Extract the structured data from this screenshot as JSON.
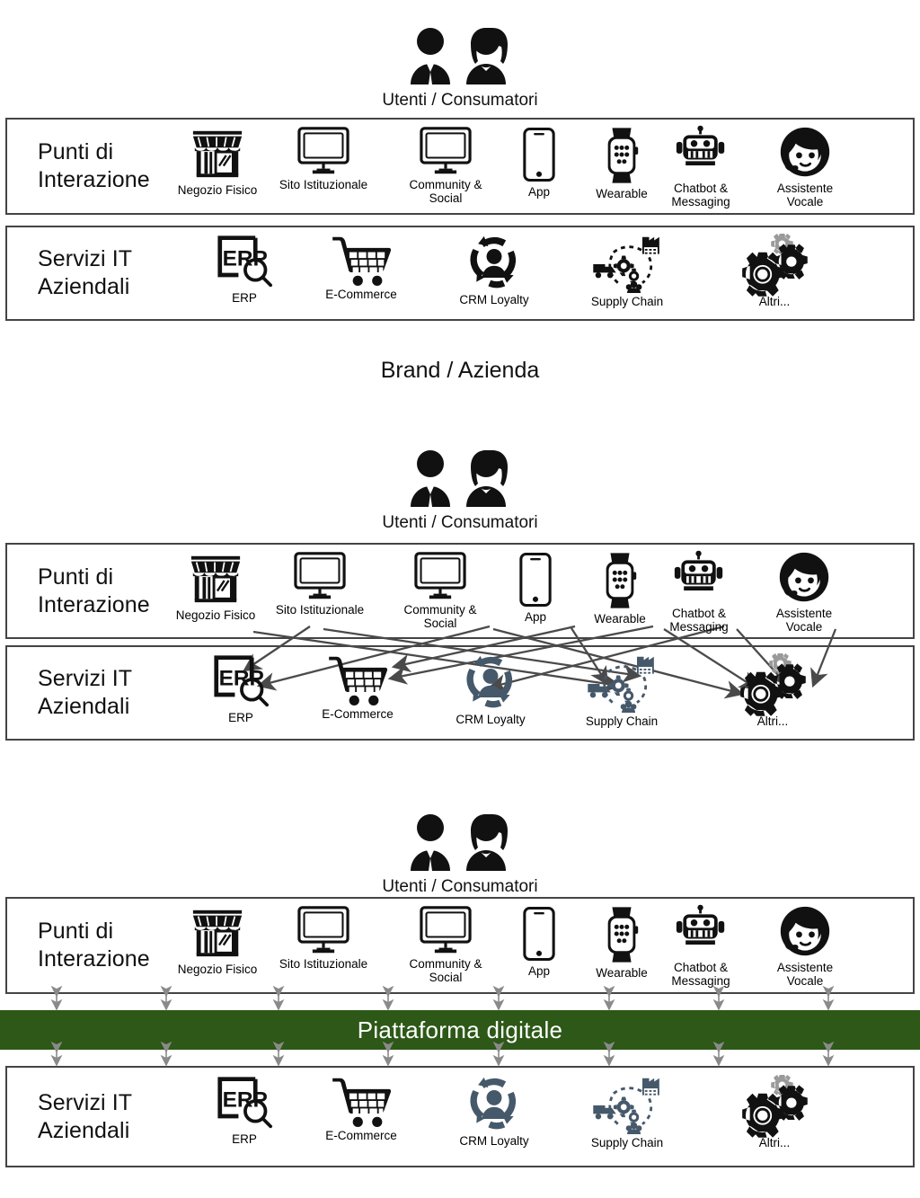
{
  "diagram": {
    "title_text": "Brand / Azienda",
    "users_label": "Utenti / Consumatori",
    "platform_label": "Piattaforma digitale",
    "row_labels": {
      "touchpoints": "Punti di\nInterazione",
      "it_services": "Servizi IT\nAziendali"
    },
    "colors": {
      "platform_green": "#2d5817",
      "panel_border": "#444444",
      "icon_black": "#111111",
      "icon_slate": "#46596b",
      "arrow_gray": "#4a4a4a",
      "connector_gray": "#6f6f6f"
    },
    "touchpoints": [
      {
        "label": "Negozio Fisico",
        "icon": "storefront-icon"
      },
      {
        "label": "Sito Istituzionale",
        "icon": "desktop-monitor-icon"
      },
      {
        "label": "Community &\nSocial",
        "icon": "desktop-monitor-icon"
      },
      {
        "label": "App",
        "icon": "smartphone-icon"
      },
      {
        "label": "Wearable",
        "icon": "smartwatch-icon"
      },
      {
        "label": "Chatbot &\nMessaging",
        "icon": "robot-icon"
      },
      {
        "label": "Assistente\nVocale",
        "icon": "headset-person-icon"
      }
    ],
    "it_services": [
      {
        "label": "ERP",
        "icon": "erp-search-icon"
      },
      {
        "label": "E-Commerce",
        "icon": "shopping-cart-icon"
      },
      {
        "label": "CRM Loyalty",
        "icon": "crm-cycle-person-icon"
      },
      {
        "label": "Supply Chain",
        "icon": "supply-chain-icon"
      },
      {
        "label": "Altri...",
        "icon": "gears-icon"
      }
    ],
    "panels": [
      {
        "id": "panel-1-silos",
        "has_arrows": false,
        "has_platform": false,
        "caption_below": "Brand / Azienda"
      },
      {
        "id": "panel-2-point-to-point",
        "has_arrows": true,
        "has_platform": false,
        "caption_below": ""
      },
      {
        "id": "panel-3-digital-platform",
        "has_arrows": false,
        "has_platform": true,
        "caption_below": ""
      }
    ],
    "panel2_connections": [
      {
        "from": "Sito Istituzionale",
        "to": "ERP"
      },
      {
        "from": "Community & Social",
        "to": "ERP"
      },
      {
        "from": "Wearable",
        "to": "E-Commerce"
      },
      {
        "from": "Chatbot & Messaging",
        "to": "E-Commerce"
      },
      {
        "from": "App",
        "to": "CRM Loyalty"
      },
      {
        "from": "Negozio Fisico",
        "to": "Supply Chain"
      },
      {
        "from": "Sito Istituzionale",
        "to": "Supply Chain"
      },
      {
        "from": "App",
        "to": "Supply Chain"
      },
      {
        "from": "Community & Social",
        "to": "Altri..."
      },
      {
        "from": "Wearable",
        "to": "Altri..."
      },
      {
        "from": "Chatbot & Messaging",
        "to": "Altri..."
      },
      {
        "from": "Assistente Vocale",
        "to": "Altri..."
      }
    ],
    "panel3_connector_count_top": 8,
    "panel3_connector_count_bottom": 8
  }
}
